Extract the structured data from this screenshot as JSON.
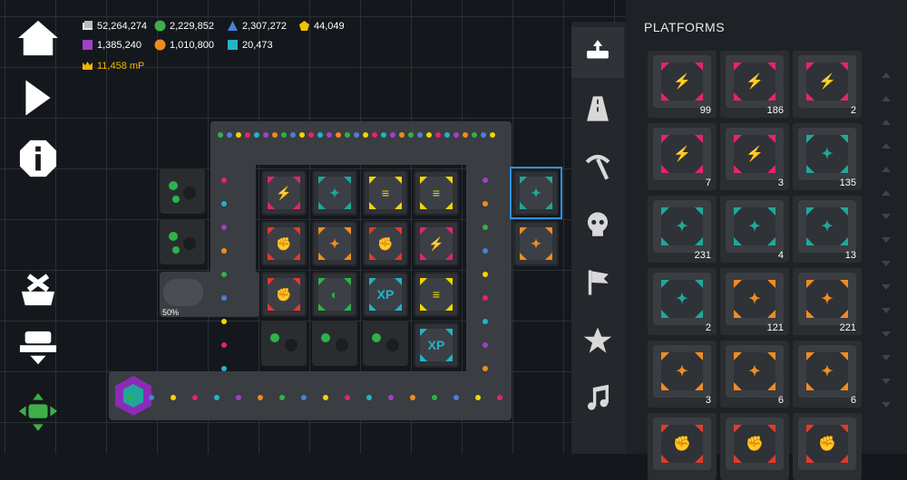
{
  "resources": [
    {
      "id": "cash",
      "value": "52,264,274",
      "color": "#e8e8e8"
    },
    {
      "id": "green",
      "value": "2,229,852",
      "color": "#3fae49"
    },
    {
      "id": "blue",
      "value": "2,307,272",
      "color": "#4a7fd6"
    },
    {
      "id": "gold",
      "value": "44,049",
      "color": "#f2c200"
    },
    {
      "id": "purple",
      "value": "1,385,240",
      "color": "#a040c8"
    },
    {
      "id": "orange",
      "value": "1,010,800",
      "color": "#f08c1e"
    },
    {
      "id": "cyan",
      "value": "20,473",
      "color": "#21b4c8"
    }
  ],
  "master_points": "11,458 mP",
  "left_buttons": [
    "home-icon",
    "play-icon",
    "info-icon",
    "demolish-icon",
    "stack-icon",
    "move-icon"
  ],
  "factory_progress": "50%",
  "grid_tiles": [
    {
      "c": "#e8236b",
      "g": "⚡"
    },
    {
      "c": "#1fa89a",
      "g": "✦"
    },
    {
      "c": "#f2d500",
      "g": "≡"
    },
    {
      "c": "#f2d500",
      "g": "≡"
    },
    {
      "c": "#e5382d",
      "g": "✊"
    },
    {
      "c": "#f08c1e",
      "g": "✦"
    },
    {
      "c": "#e5382d",
      "g": "✊"
    },
    {
      "c": "#e8236b",
      "g": "⚡"
    },
    {
      "c": "#e5382d",
      "g": "✊"
    },
    {
      "c": "#2fb24a",
      "g": "◐"
    },
    {
      "c": "#21b4c8",
      "g": "XP"
    },
    {
      "c": "#f2d500",
      "g": "≡"
    },
    {
      "c": "#21b4c8",
      "g": "XP"
    }
  ],
  "selected_tiles": [
    {
      "c": "#1fa89a",
      "g": "✦"
    },
    {
      "c": "#f08c1e",
      "g": "✦"
    }
  ],
  "rail_tabs": [
    "platforms-icon",
    "road-icon",
    "pickaxe-icon",
    "skull-icon",
    "flag-icon",
    "star-icon",
    "music-icon"
  ],
  "panel": {
    "title": "PLATFORMS",
    "cards": [
      {
        "color": "#e8236b",
        "count": "99"
      },
      {
        "color": "#e8236b",
        "count": "186"
      },
      {
        "color": "#e8236b",
        "count": "2"
      },
      {
        "color": "#e8236b",
        "count": "7"
      },
      {
        "color": "#e8236b",
        "count": "3"
      },
      {
        "color": "#1fa89a",
        "count": "135"
      },
      {
        "color": "#1fa89a",
        "count": "231"
      },
      {
        "color": "#1fa89a",
        "count": "4"
      },
      {
        "color": "#1fa89a",
        "count": "13"
      },
      {
        "color": "#1fa89a",
        "count": "2"
      },
      {
        "color": "#f08c1e",
        "count": "121"
      },
      {
        "color": "#f08c1e",
        "count": "221"
      },
      {
        "color": "#f08c1e",
        "count": "3"
      },
      {
        "color": "#f08c1e",
        "count": "6"
      },
      {
        "color": "#f08c1e",
        "count": "6"
      },
      {
        "color": "#e5382d",
        "count": ""
      },
      {
        "color": "#e5382d",
        "count": ""
      },
      {
        "color": "#e5382d",
        "count": ""
      }
    ]
  }
}
